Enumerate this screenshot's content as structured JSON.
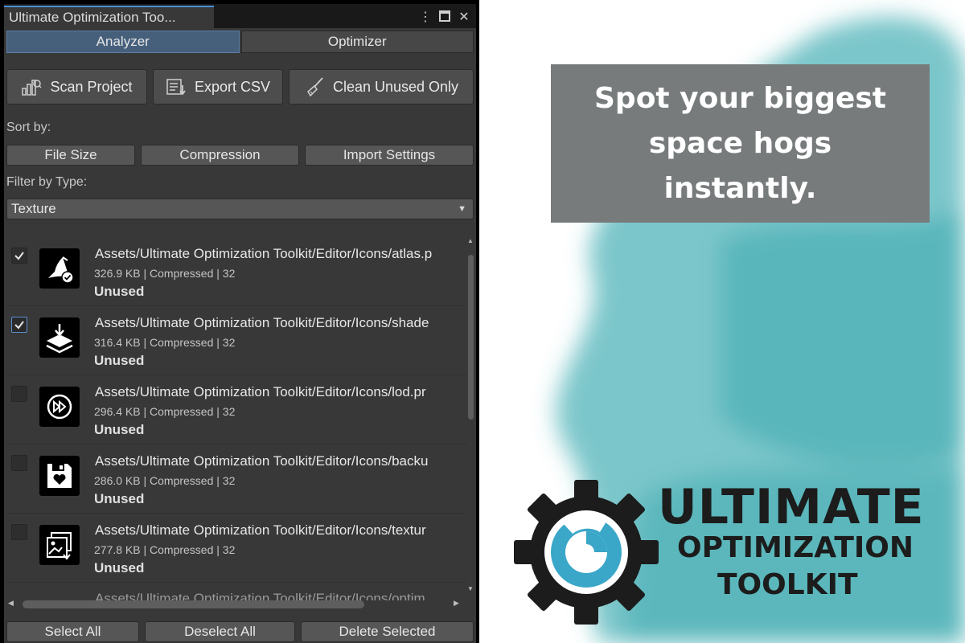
{
  "window": {
    "title": "Ultimate Optimization Too...",
    "menu_icon": "kebab-menu-icon",
    "maximize_icon": "maximize-icon",
    "close_icon": "close-icon"
  },
  "mode_tabs": [
    {
      "label": "Analyzer",
      "active": true
    },
    {
      "label": "Optimizer",
      "active": false
    }
  ],
  "actions": {
    "scan": {
      "label": "Scan Project",
      "icon": "scan-icon"
    },
    "export": {
      "label": "Export CSV",
      "icon": "export-icon"
    },
    "clean": {
      "label": "Clean Unused Only",
      "icon": "broom-icon"
    }
  },
  "sort": {
    "label": "Sort by:",
    "options": [
      "File Size",
      "Compression",
      "Import Settings"
    ]
  },
  "filter": {
    "label": "Filter by Type:",
    "selected": "Texture"
  },
  "assets": [
    {
      "path": "Assets/Ultimate Optimization Toolkit/Editor/Icons/atlas.p",
      "info": "326.9 KB | Compressed | 32",
      "status": "Unused",
      "checked": true,
      "icon": "wizard-hat-icon"
    },
    {
      "path": "Assets/Ultimate Optimization Toolkit/Editor/Icons/shade",
      "info": "316.4 KB | Compressed | 32",
      "status": "Unused",
      "checked": true,
      "icon": "layers-download-icon"
    },
    {
      "path": "Assets/Ultimate Optimization Toolkit/Editor/Icons/lod.pr",
      "info": "296.4 KB | Compressed | 32",
      "status": "Unused",
      "checked": false,
      "icon": "fast-forward-icon"
    },
    {
      "path": "Assets/Ultimate Optimization Toolkit/Editor/Icons/backu",
      "info": "286.0 KB | Compressed | 32",
      "status": "Unused",
      "checked": false,
      "icon": "floppy-heart-icon"
    },
    {
      "path": "Assets/Ultimate Optimization Toolkit/Editor/Icons/textur",
      "info": "277.8 KB | Compressed | 32",
      "status": "Unused",
      "checked": false,
      "icon": "image-download-icon"
    }
  ],
  "partial_row": "Assets/Ultimate Optimization Toolkit/Editor/Icons/optim",
  "bottom": {
    "select_all": "Select All",
    "deselect_all": "Deselect All",
    "delete_selected": "Delete Selected"
  },
  "promo": {
    "callout": "Spot your biggest space hogs instantly.",
    "logo_line1": "ULTIMATE",
    "logo_line2": "OPTIMIZATION",
    "logo_line3": "TOOLKIT",
    "accent_color": "#4fb3b8",
    "logo_color": "#1c1c1c"
  }
}
